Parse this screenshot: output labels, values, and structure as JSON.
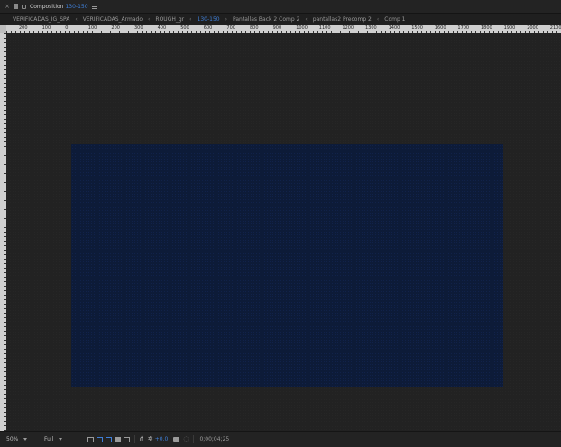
{
  "panel": {
    "title": "Composition",
    "comp_name": "130-150"
  },
  "breadcrumbs": [
    {
      "label": "VERIFICADAS_IG_SPA"
    },
    {
      "label": "VERIFICADAS_Armado"
    },
    {
      "label": "ROUGH_gr"
    },
    {
      "label": "130-150"
    },
    {
      "label": "Pantallas Back 2 Comp 2"
    },
    {
      "label": "pantallas2 Precomp 2"
    },
    {
      "label": "Comp 1"
    }
  ],
  "ruler_labels": [
    "200",
    "100",
    "0",
    "100",
    "200",
    "300",
    "400",
    "500",
    "600",
    "700",
    "800",
    "900",
    "1000",
    "1100",
    "1200",
    "1300",
    "1400",
    "1500",
    "1600",
    "1700",
    "1800",
    "1900",
    "2000",
    "2100"
  ],
  "toolbar": {
    "zoom": "50%",
    "resolution": "Full",
    "exposure": "+0.0",
    "timecode": "0;00;04;25"
  },
  "colors": {
    "accent": "#3f7fd8",
    "canvas": "#0d1b38",
    "pasteboard": "#222222"
  }
}
